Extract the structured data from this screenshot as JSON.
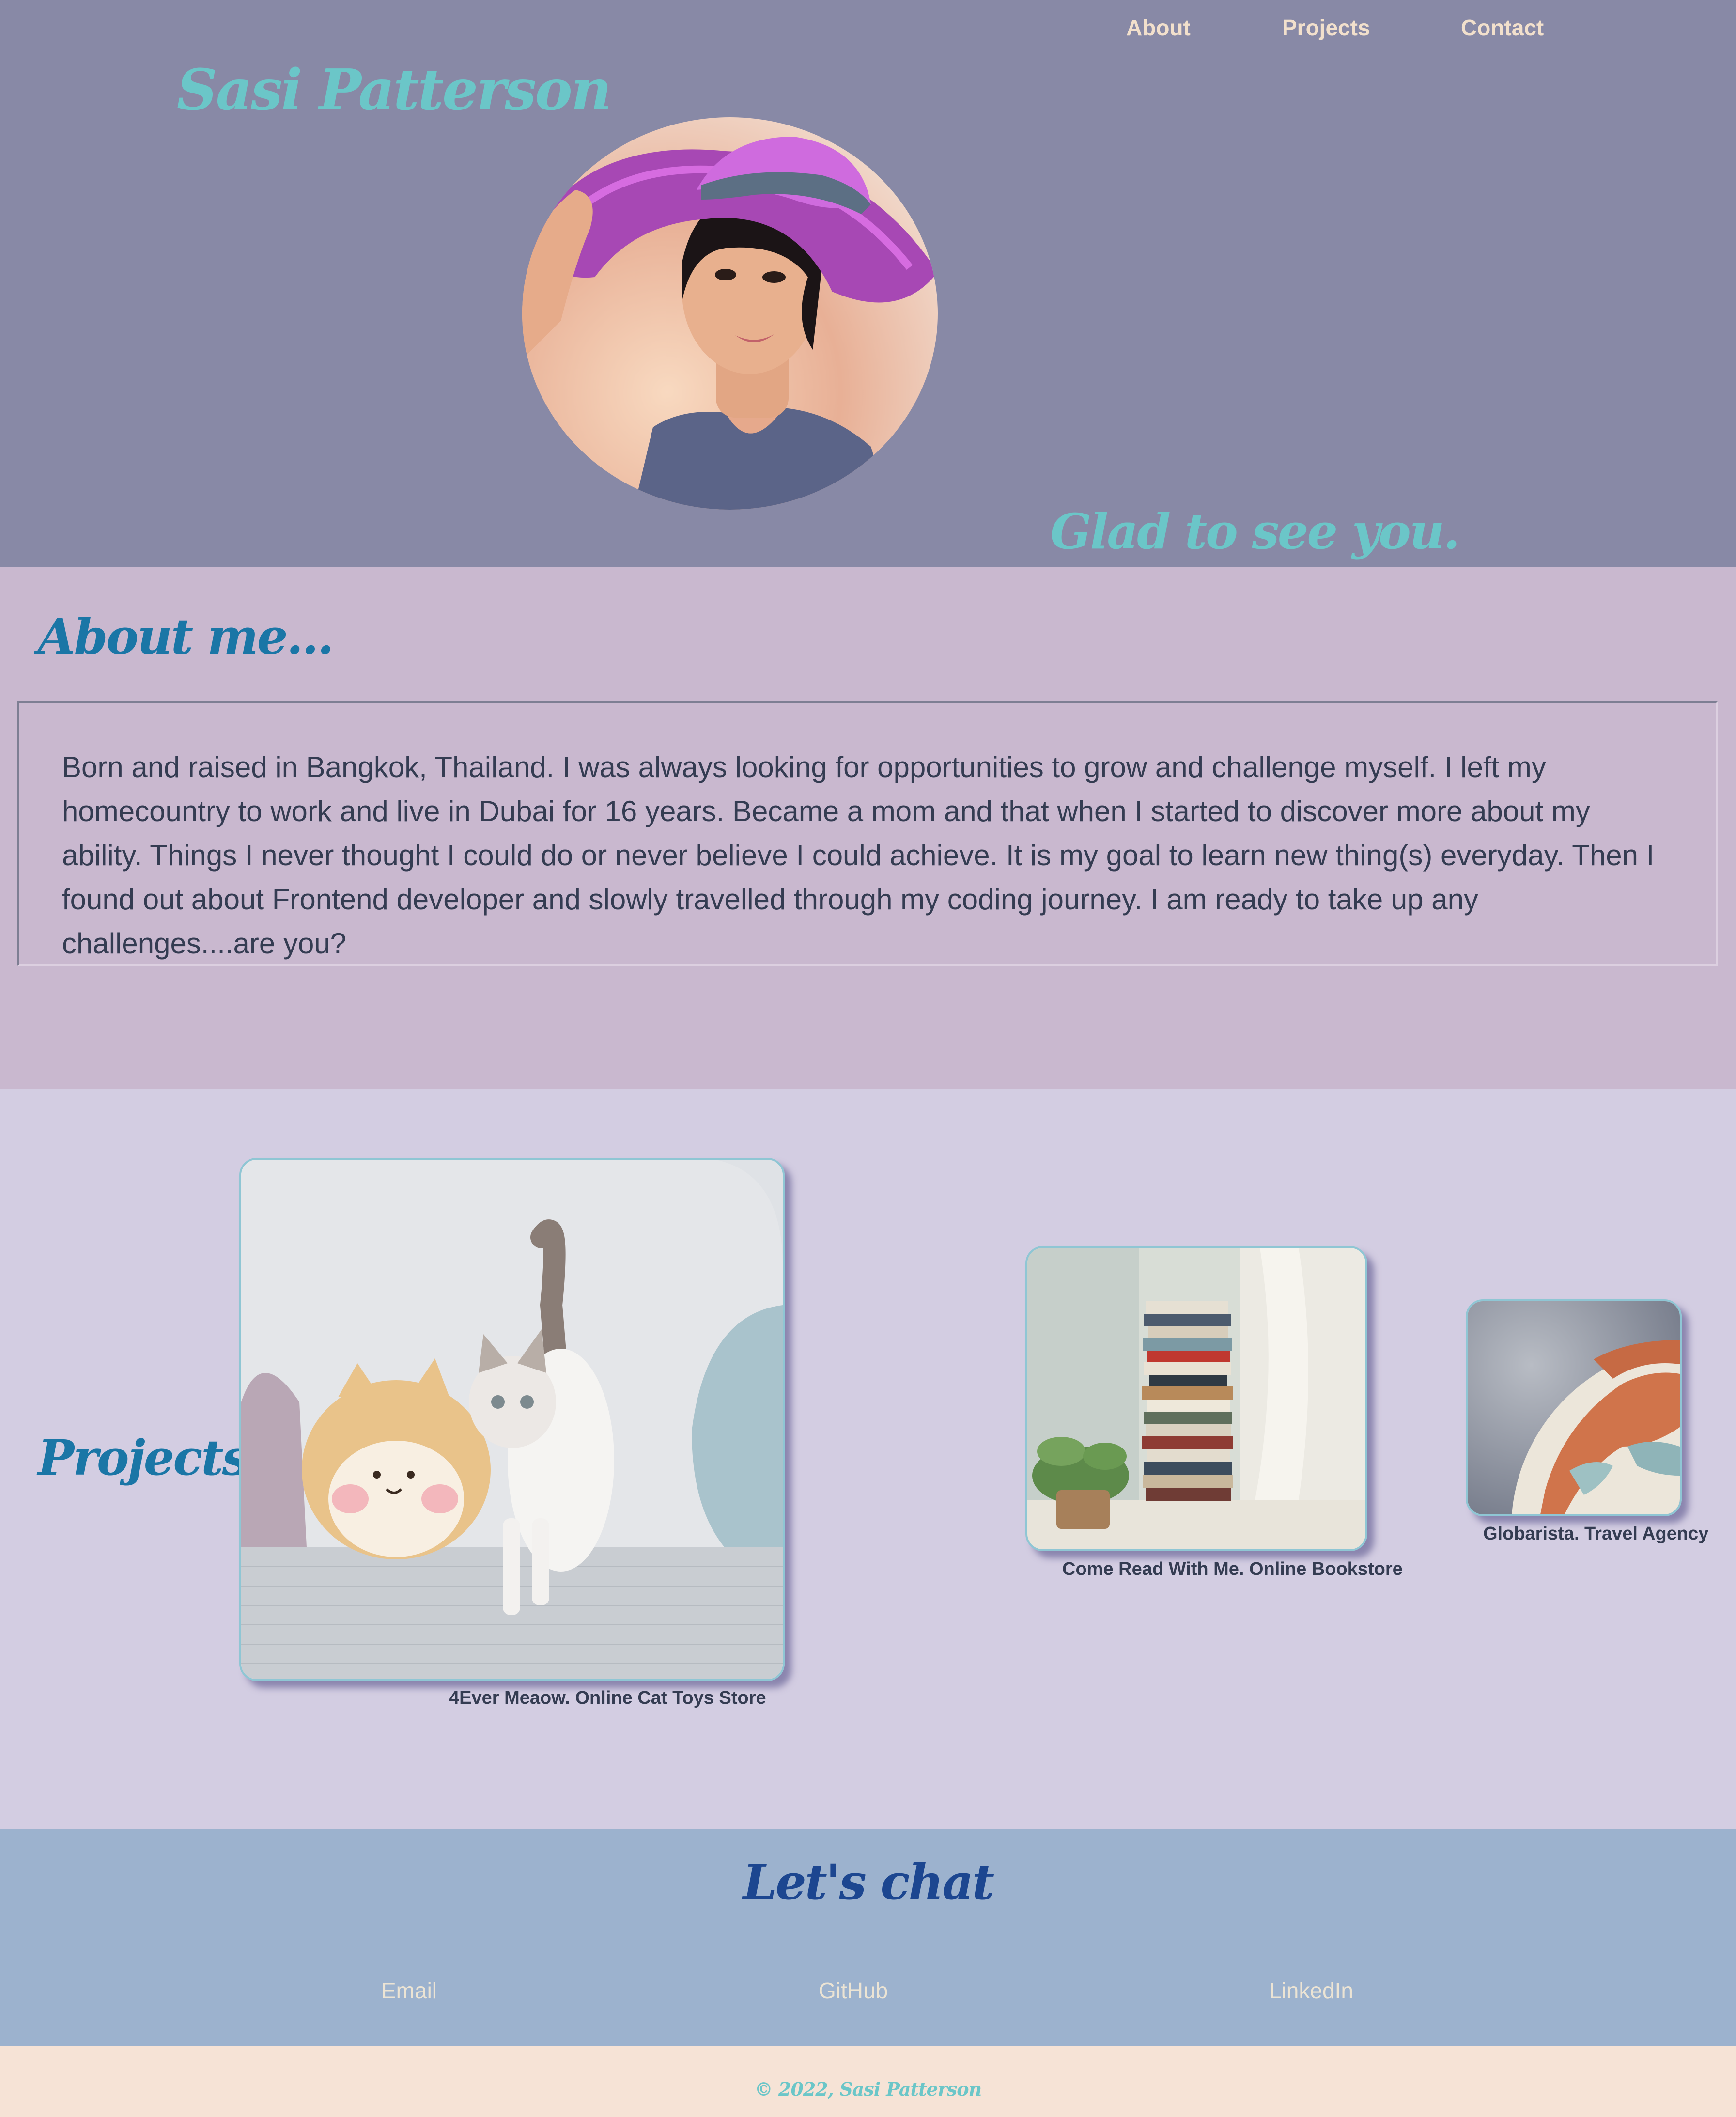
{
  "nav": {
    "items": [
      "About",
      "Projects",
      "Contact"
    ]
  },
  "header": {
    "site_name": "Sasi Patterson",
    "greeting": "Glad to see you."
  },
  "about": {
    "title": "About me...",
    "text": "Born and raised in Bangkok, Thailand. I was always looking for opportunities to grow and challenge myself. I left my homecountry to work and live in Dubai for 16 years. Became a mom and that when I started to discover more about my ability. Things I never thought I could do or never believe I could achieve. It is my goal to learn new thing(s) everyday. Then I found out about Frontend developer and slowly travelled through my coding journey. I am ready to take up any challenges....are you?"
  },
  "projects": {
    "title": "Projects",
    "items": [
      {
        "caption": "4Ever Meaow. Online Cat Toys Store",
        "image": "cat-plush-photo"
      },
      {
        "caption": "Come Read With Me. Online Bookstore",
        "image": "book-stack-photo"
      },
      {
        "caption": "Globarista. Travel Agency",
        "image": "globe-photo"
      }
    ]
  },
  "contact": {
    "title": "Let's chat",
    "links": [
      "Email",
      "GitHub",
      "LinkedIn"
    ]
  },
  "footer": {
    "copyright": "© 2022, Sasi Patterson"
  },
  "colors": {
    "header_bg": "#8889a6",
    "about_bg": "#c9b8cf",
    "projects_bg": "#d3cde2",
    "chat_bg": "#9cb2ce",
    "footer_bg": "#f6e3d6",
    "teal_accent": "#6bc6c8",
    "heading_blue": "#1a76a6",
    "nav_text": "#f2e0cc"
  }
}
